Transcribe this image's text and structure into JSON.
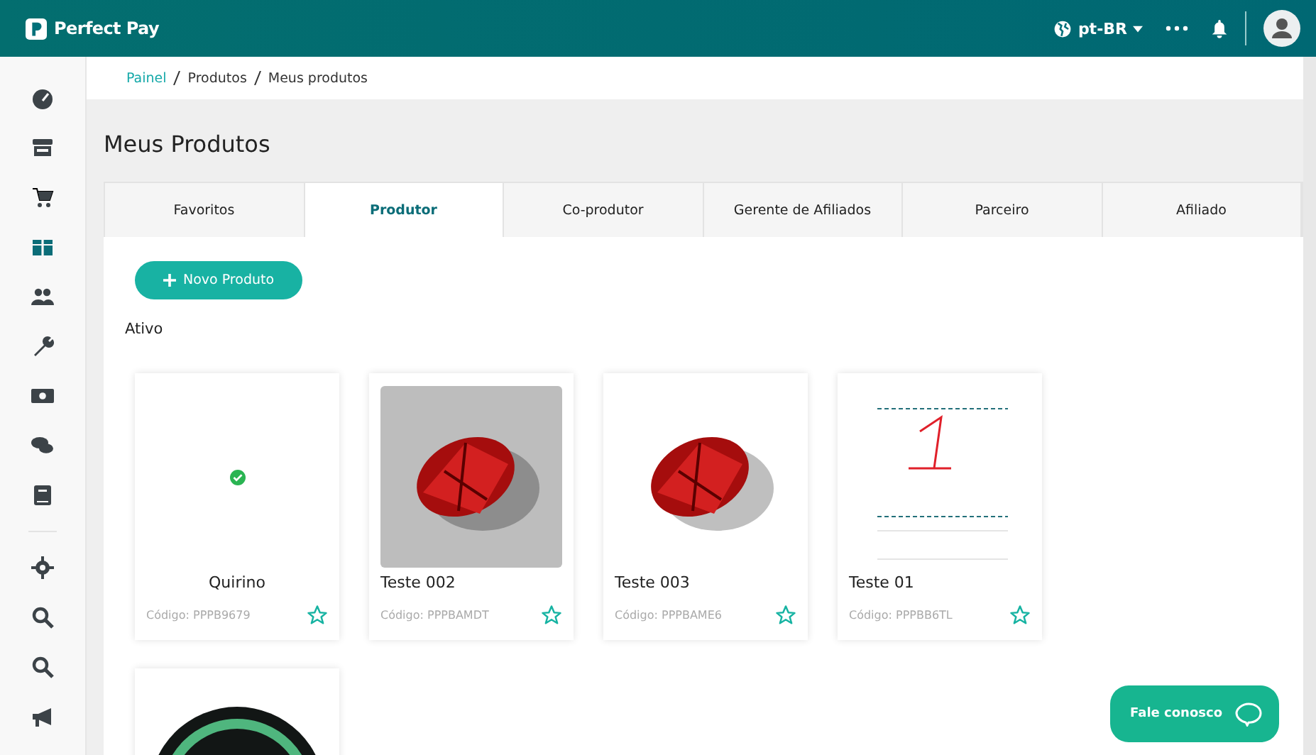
{
  "topbar": {
    "brand": "Perfect Pay",
    "language": "pt-BR"
  },
  "sidebar": {
    "items": [
      {
        "selected": false
      },
      {
        "selected": false
      },
      {
        "selected": false
      },
      {
        "selected": true
      },
      {
        "selected": false
      },
      {
        "selected": false
      },
      {
        "selected": false
      },
      {
        "selected": false
      },
      {
        "selected": false
      },
      {
        "selected": false
      },
      {
        "selected": false
      },
      {
        "selected": false
      },
      {
        "selected": false
      }
    ]
  },
  "breadcrumb": [
    "Painel",
    "Produtos",
    "Meus produtos"
  ],
  "title": "Meus Produtos",
  "tabs": [
    {
      "label": "Favoritos",
      "selected": false
    },
    {
      "label": "Produtor",
      "selected": true
    },
    {
      "label": "Co-produtor",
      "selected": false
    },
    {
      "label": "Gerente de Afiliados",
      "selected": false
    },
    {
      "label": "Parceiro",
      "selected": false
    },
    {
      "label": "Afiliado",
      "selected": false
    }
  ],
  "new_button": "Novo Produto",
  "section": "Ativo",
  "products": [
    {
      "name": "Quirino",
      "code": "Código: PPPB9679",
      "kind": "check",
      "favorite": false
    },
    {
      "name": "Teste 002",
      "code": "Código: PPPBAMDT",
      "kind": "gem-gray",
      "favorite": false
    },
    {
      "name": "Teste 003",
      "code": "Código: PPPBAME6",
      "kind": "gem",
      "favorite": false
    },
    {
      "name": "Teste 01",
      "code": "Código: PPPBB6TL",
      "kind": "sketch",
      "favorite": false
    },
    {
      "kind": "logo"
    }
  ],
  "chat_button": "Fale conosco"
}
